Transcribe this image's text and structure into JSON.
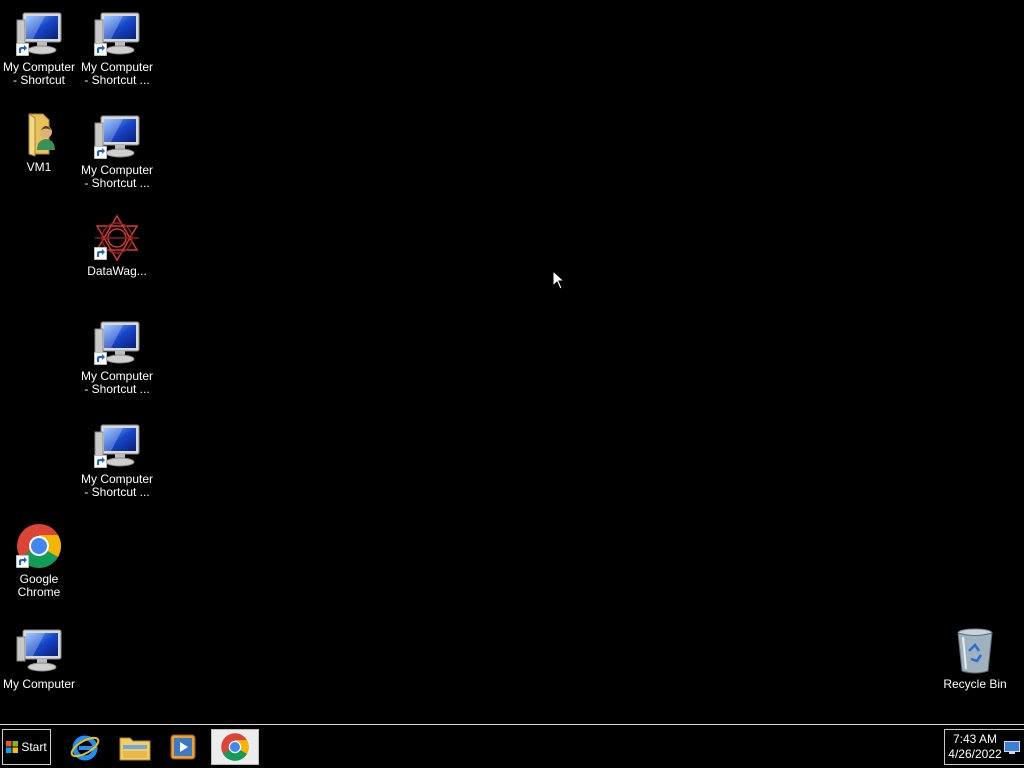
{
  "desktop": {
    "icons": [
      {
        "label_line1": "My Computer",
        "label_line2": "- Shortcut",
        "icon": "computer-icon"
      },
      {
        "label_line1": "My Computer",
        "label_line2": "- Shortcut ...",
        "icon": "computer-icon"
      },
      {
        "label_line1": "VM1",
        "label_line2": "",
        "icon": "user-folder-icon"
      },
      {
        "label_line1": "My Computer",
        "label_line2": "- Shortcut ...",
        "icon": "computer-icon"
      },
      {
        "label_line1": "DataWag...",
        "label_line2": "",
        "icon": "datawagon-icon"
      },
      {
        "label_line1": "My Computer",
        "label_line2": "- Shortcut ...",
        "icon": "computer-icon"
      },
      {
        "label_line1": "My Computer",
        "label_line2": "- Shortcut ...",
        "icon": "computer-icon"
      },
      {
        "label_line1": "Google",
        "label_line2": "Chrome",
        "icon": "chrome-icon"
      },
      {
        "label_line1": "My Computer",
        "label_line2": "",
        "icon": "computer-icon"
      },
      {
        "label_line1": "Recycle Bin",
        "label_line2": "",
        "icon": "recycle-bin-icon"
      }
    ]
  },
  "taskbar": {
    "start_label": "Start",
    "pinned": [
      {
        "icon": "internet-explorer-icon"
      },
      {
        "icon": "file-explorer-icon"
      },
      {
        "icon": "media-player-icon"
      },
      {
        "icon": "chrome-icon",
        "active": true
      }
    ],
    "clock": {
      "time": "7:43 AM",
      "date": "4/26/2022"
    }
  },
  "colors": {
    "desktop_bg": "#000000",
    "taskbar_bg": "#000000",
    "label_text": "#ffffff"
  }
}
